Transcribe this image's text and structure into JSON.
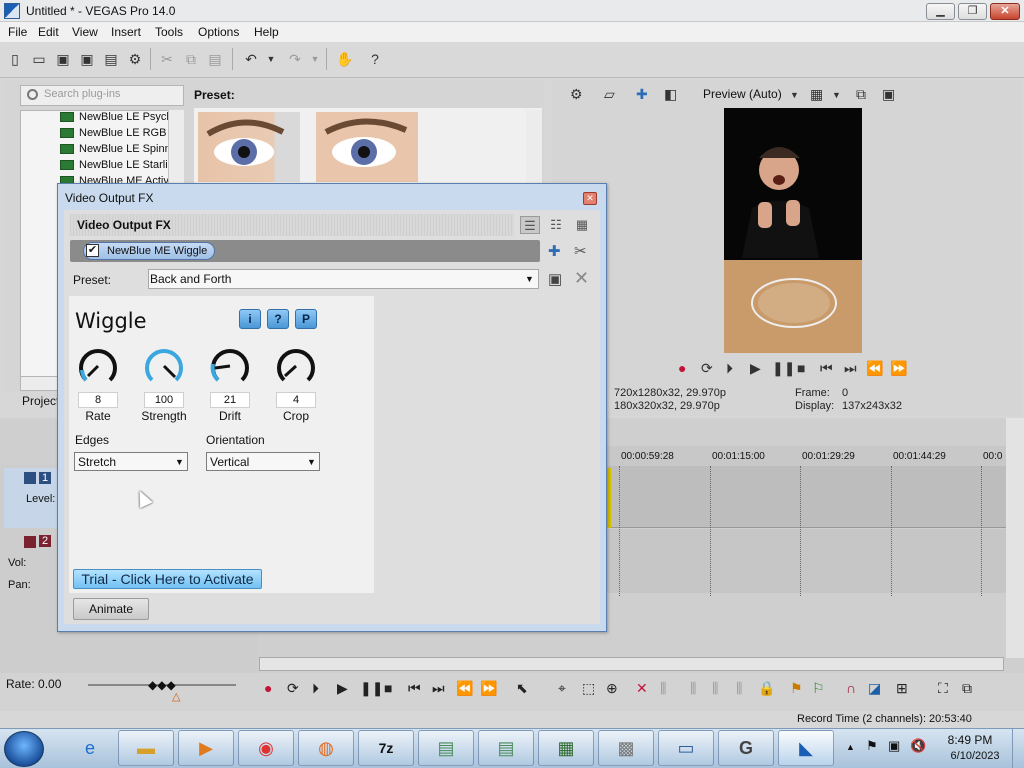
{
  "window": {
    "title": "Untitled * - VEGAS Pro 14.0",
    "min": "▁",
    "max": "❐",
    "close": "✕"
  },
  "menu": [
    "File",
    "Edit",
    "View",
    "Insert",
    "Tools",
    "Options",
    "Help"
  ],
  "plugins": {
    "search_placeholder": "Search plug-ins",
    "items": [
      "NewBlue LE Psych",
      "NewBlue LE RGB S",
      "NewBlue LE Spinni",
      "NewBlue LE Starlig",
      "NewBlue ME Activ"
    ],
    "preset_label": "Preset:",
    "project_tab": "Project"
  },
  "preview": {
    "mode": "Preview (Auto)",
    "project_info": "720x1280x32, 29.970p",
    "preview_info": "180x320x32, 29.970p",
    "frame_label": "Frame:",
    "frame_value": "0",
    "display_label": "Display:",
    "display_value": "137x243x32"
  },
  "timeline": {
    "ruler": [
      "00:00:59:28",
      "00:01:15:00",
      "00:01:29:29",
      "00:01:44:29",
      "00:0"
    ],
    "track1_num": "1",
    "track1_level": "Level:",
    "track2_num": "2",
    "track2_vol": "Vol:",
    "track2_pan": "Pan:"
  },
  "transport": {
    "rate_label": "Rate: 0.00",
    "record_time": "Record Time (2 channels): 20:53:40"
  },
  "dialog": {
    "title": "Video Output FX",
    "header": "Video Output FX",
    "chain_item": "NewBlue ME Wiggle",
    "preset_label": "Preset:",
    "preset_value": "Back and Forth",
    "plugin_title": "Wiggle",
    "info_btn": "i",
    "help_btn": "?",
    "preset_btn": "P",
    "knobs": [
      {
        "label": "Rate",
        "value": "8"
      },
      {
        "label": "Strength",
        "value": "100"
      },
      {
        "label": "Drift",
        "value": "21"
      },
      {
        "label": "Crop",
        "value": "4"
      }
    ],
    "edges_label": "Edges",
    "edges_value": "Stretch",
    "orientation_label": "Orientation",
    "orientation_value": "Vertical",
    "trial_label": "Trial - Click Here to Activate",
    "animate_label": "Animate"
  },
  "taskbar": {
    "time": "8:49 PM",
    "date": "6/10/2023"
  }
}
